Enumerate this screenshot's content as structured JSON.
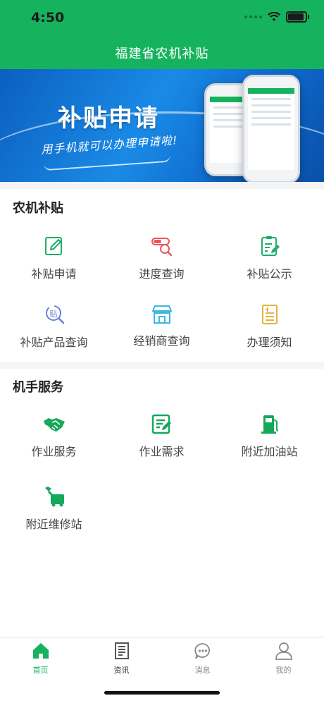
{
  "status": {
    "time": "4:50"
  },
  "header": {
    "title": "福建省农机补贴"
  },
  "banner": {
    "title": "补贴申请",
    "subtitle": "用手机就可以办理申请啦!"
  },
  "sections": [
    {
      "title": "农机补贴",
      "items": [
        {
          "label": "补贴申请",
          "icon": "edit-icon",
          "color": "#1fae6a"
        },
        {
          "label": "进度查询",
          "icon": "progress-search-icon",
          "color": "#e8595f"
        },
        {
          "label": "补贴公示",
          "icon": "clipboard-edit-icon",
          "color": "#1fae6a"
        },
        {
          "label": "补贴产品查询",
          "icon": "subsidy-search-icon",
          "color": "#6b7fd7"
        },
        {
          "label": "经销商查询",
          "icon": "store-icon",
          "color": "#3fb6e0"
        },
        {
          "label": "办理须知",
          "icon": "notice-doc-icon",
          "color": "#e6b33e"
        }
      ]
    },
    {
      "title": "机手服务",
      "items": [
        {
          "label": "作业服务",
          "icon": "handshake-icon",
          "color": "#16a85a"
        },
        {
          "label": "作业需求",
          "icon": "demand-edit-icon",
          "color": "#16a85a"
        },
        {
          "label": "附近加油站",
          "icon": "gas-station-icon",
          "color": "#16a85a"
        },
        {
          "label": "附近维修站",
          "icon": "repair-wrench-icon",
          "color": "#16a85a"
        }
      ]
    }
  ],
  "tabbar": {
    "active": 0,
    "active_color": "#16b35e",
    "tabs": [
      {
        "label": "首页",
        "icon": "home-icon"
      },
      {
        "label": "资讯",
        "icon": "news-icon"
      },
      {
        "label": "消息",
        "icon": "message-icon"
      },
      {
        "label": "我的",
        "icon": "user-icon"
      }
    ]
  }
}
